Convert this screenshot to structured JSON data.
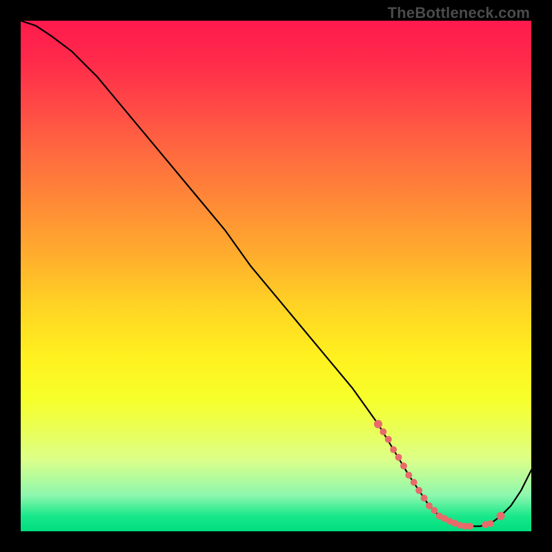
{
  "watermark": "TheBottleneck.com",
  "colors": {
    "curve": "#000000",
    "dot": "#e86a6a",
    "gradient_top": "#ff1a4d",
    "gradient_bottom": "#00dd7f"
  },
  "chart_data": {
    "type": "line",
    "title": "",
    "xlabel": "",
    "ylabel": "",
    "xlim": [
      0,
      100
    ],
    "ylim": [
      0,
      100
    ],
    "series": [
      {
        "name": "curve",
        "x": [
          0,
          3,
          6,
          10,
          15,
          20,
          25,
          30,
          35,
          40,
          45,
          50,
          55,
          60,
          65,
          70,
          73,
          76,
          78,
          80,
          82,
          84,
          86,
          88,
          90,
          92,
          94,
          96,
          98,
          100
        ],
        "y": [
          100,
          99,
          97,
          94,
          89,
          83,
          77,
          71,
          65,
          59,
          52,
          46,
          40,
          34,
          28,
          21,
          16,
          11,
          8,
          5,
          3,
          2,
          1.2,
          1,
          1,
          1.5,
          3,
          5,
          8,
          12
        ]
      }
    ],
    "highlight_dots": {
      "x": [
        70,
        71,
        72,
        73,
        74,
        75,
        76,
        77,
        78,
        79,
        80,
        81,
        82,
        83,
        84,
        85,
        86,
        87,
        88,
        91,
        92,
        94
      ],
      "y": [
        21,
        19.5,
        18,
        16,
        14.5,
        12.8,
        11,
        9.6,
        8,
        6.5,
        5,
        4.1,
        3,
        2.5,
        2,
        1.6,
        1.2,
        1.0,
        1.0,
        1.3,
        1.5,
        3
      ],
      "r": [
        6,
        5,
        5,
        5,
        5,
        5,
        5,
        5,
        5,
        5,
        5,
        5,
        5,
        5,
        5,
        5,
        5,
        5,
        5,
        5,
        5,
        6
      ]
    }
  }
}
